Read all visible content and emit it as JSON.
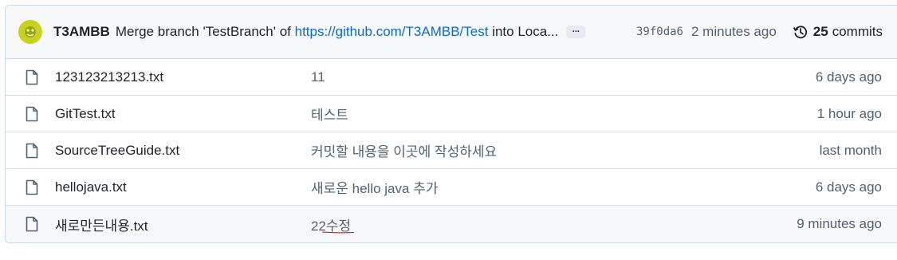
{
  "latest_commit": {
    "author": "T3AMBB",
    "message_prefix": "Merge branch 'TestBranch' of",
    "message_link": "https://github.com/T3AMBB/Test",
    "message_suffix": "into Loca...",
    "ellipsis": "...",
    "sha": "39f0da6",
    "time": "2 minutes ago",
    "commits_count": "25",
    "commits_label": "commits",
    "avatar_color": "#c7d31f"
  },
  "files": [
    {
      "name": "123123213213.txt",
      "message": "11",
      "time": "6 days ago",
      "icon": "file-icon"
    },
    {
      "name": "GitTest.txt",
      "message": "테스트",
      "time": "1 hour ago",
      "icon": "file-icon"
    },
    {
      "name": "SourceTreeGuide.txt",
      "message": "커밋할 내용을 이곳에 작성하세요",
      "time": "last month",
      "icon": "file-icon"
    },
    {
      "name": "hellojava.txt",
      "message": "새로운 hello java 추가",
      "time": "6 days ago",
      "icon": "file-icon"
    },
    {
      "name": "새로만든내용.txt",
      "message": "22수정",
      "time": "9 minutes ago",
      "icon": "file-icon"
    }
  ],
  "colors": {
    "link": "#0969da",
    "muted": "#57606a",
    "border": "#d0d7de",
    "annotation": "#e00000"
  }
}
